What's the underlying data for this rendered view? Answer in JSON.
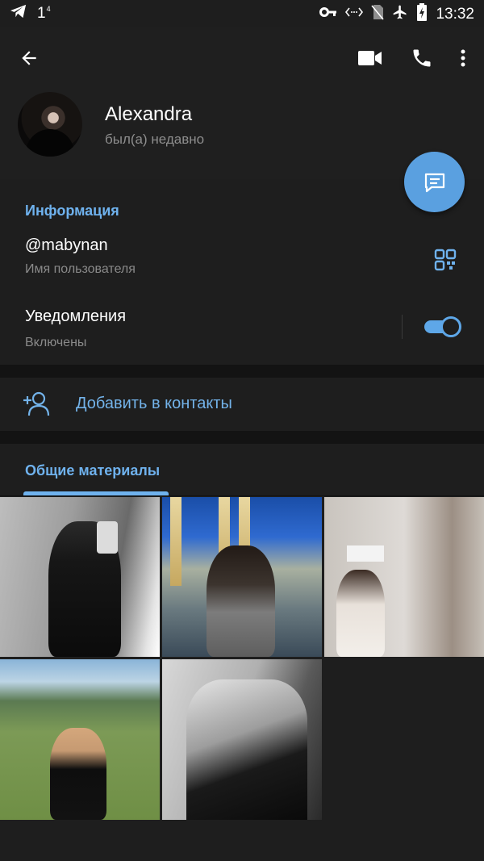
{
  "status_bar": {
    "left_number": "1",
    "left_superscript": "4",
    "time": "13:32",
    "icons": [
      "telegram-icon",
      "key-icon",
      "data-sync-icon",
      "no-sim-icon",
      "airplane-icon",
      "battery-charging-icon"
    ]
  },
  "header": {
    "back_icon": "arrow-left-icon",
    "actions": [
      "video-call-icon",
      "phone-icon",
      "more-vert-icon"
    ],
    "user_name": "Alexandra",
    "user_status": "был(а) недавно",
    "fab_icon": "message-icon"
  },
  "info": {
    "section_title": "Информация",
    "username": "@mabynan",
    "username_label": "Имя пользователя",
    "qr_icon": "qr-code-icon",
    "notifications_title": "Уведомления",
    "notifications_sub": "Включены",
    "notifications_enabled": true
  },
  "contacts": {
    "add_icon": "add-user-icon",
    "add_label": "Добавить в контакты"
  },
  "media": {
    "tab_title": "Общие материалы",
    "items": [
      {
        "name": "media-photo-1"
      },
      {
        "name": "media-photo-2"
      },
      {
        "name": "media-photo-3"
      },
      {
        "name": "media-photo-4"
      },
      {
        "name": "media-photo-5"
      }
    ]
  },
  "colors": {
    "accent": "#6fb2ee",
    "fab": "#5aa0e0",
    "background": "#131313",
    "surface": "#1e1e1e"
  }
}
